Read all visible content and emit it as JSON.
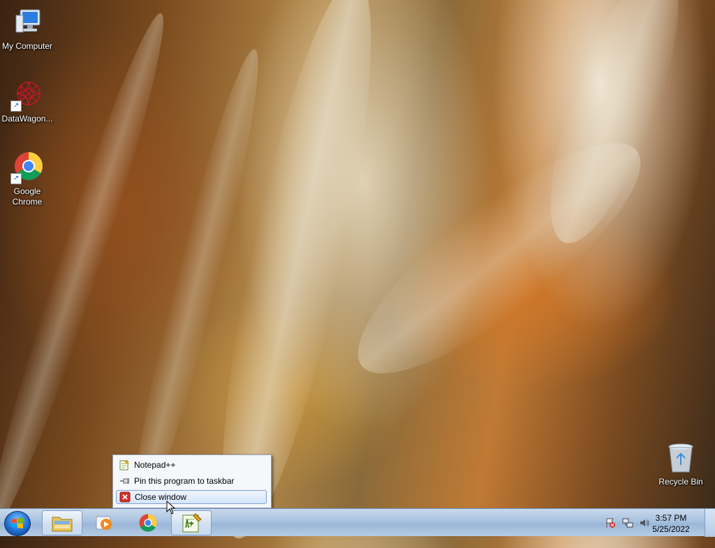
{
  "desktop": {
    "icons": [
      {
        "label": "My Computer",
        "icon": "computer-icon"
      },
      {
        "label": "DataWagon...",
        "icon": "datawagon-icon"
      },
      {
        "label": "Google Chrome",
        "icon": "chrome-icon"
      },
      {
        "label": "Recycle Bin",
        "icon": "recycle-bin-icon"
      }
    ]
  },
  "jumplist": {
    "items": [
      {
        "label": "Notepad++",
        "icon": "notepadpp-icon"
      },
      {
        "label": "Pin this program to taskbar",
        "icon": "pin-icon"
      },
      {
        "label": "Close window",
        "icon": "close-icon"
      }
    ]
  },
  "taskbar": {
    "buttons": [
      {
        "name": "Windows Explorer",
        "icon": "folder-icon"
      },
      {
        "name": "Windows Media Player",
        "icon": "media-player-icon"
      },
      {
        "name": "Google Chrome",
        "icon": "chrome-icon"
      },
      {
        "name": "Notepad++",
        "icon": "notepadpp-icon"
      }
    ],
    "clock": {
      "time": "3:57 PM",
      "date": "5/25/2022"
    }
  },
  "colors": {
    "taskbar": "#a9c2de",
    "menu_highlight": "#d5e6fb",
    "close_red": "#d9312b"
  }
}
